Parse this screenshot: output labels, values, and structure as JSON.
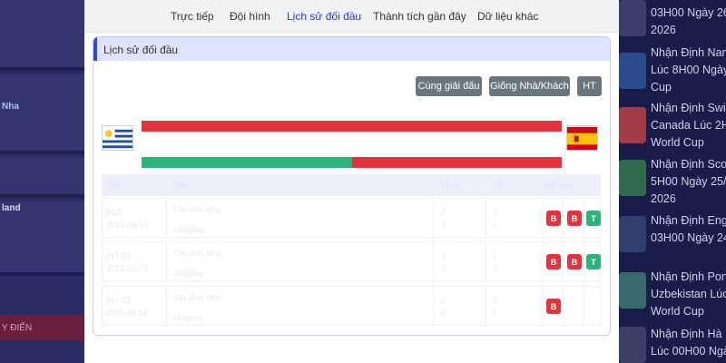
{
  "left_sidebar": {
    "item_1": "Nha",
    "item_2": "land",
    "bar_label": "Y ĐIỂN"
  },
  "right_sidebar": {
    "news": [
      {
        "lines": [
          "03H00 Ngày 26",
          "2026"
        ]
      },
      {
        "lines": [
          "Nhận Định Nam",
          "Lúc 8H00 Ngày",
          "Cup"
        ]
      },
      {
        "lines": [
          "Nhận Định Swi",
          "Canada Lúc 2H",
          "World Cup"
        ]
      },
      {
        "lines": [
          "Nhận Định Scot",
          "5H00 Ngày 25/",
          "2026"
        ]
      },
      {
        "lines": [
          "Nhận Định Eng",
          "03H00 Ngày 24"
        ]
      },
      {
        "lines": [
          "Nhận Định Port",
          "Uzbekistan Lúc",
          "World Cup"
        ]
      },
      {
        "lines": [
          "Nhận Định Hà I",
          "Lúc 00H00 Ngày"
        ]
      }
    ]
  },
  "tabs": [
    {
      "label": "Trực tiếp",
      "active": false
    },
    {
      "label": "Đội hình",
      "active": false
    },
    {
      "label": "Lịch sử đối đầu",
      "active": true
    },
    {
      "label": "Thành tích gần đây",
      "active": false
    },
    {
      "label": "Dữ liệu khác",
      "active": false
    }
  ],
  "panel": {
    "title": "Lịch sử đối đầu",
    "filters": [
      {
        "label": "Cùng giải đấu"
      },
      {
        "label": "Giống Nhà/Khách"
      },
      {
        "label": "HT"
      }
    ]
  },
  "summary": {
    "home_team_flag": "uruguay-flag",
    "away_team_flag": "spain-flag",
    "bar1_green_fraction": 0.0,
    "bar2_green_fraction": 0.5,
    "colors": {
      "win": "#2cb27a",
      "loss": "#e2343f"
    }
  },
  "table": {
    "headers": [
      "Giải",
      "Chủ",
      "Tỷ số",
      "HT",
      "Kết quả",
      ""
    ],
    "rows": [
      {
        "league": "FCC",
        "date": "2013-06-17",
        "home": "Tây Ban Nha",
        "away": "Uruguay",
        "score_home": "2",
        "score_away": "1",
        "ht_home": "2",
        "ht_away": "0",
        "results": [
          "B",
          "B",
          "T"
        ]
      },
      {
        "league": "INT CF",
        "date": "2013-02-07",
        "home": "Tây Ban Nha",
        "away": "Uruguay",
        "score_home": "1",
        "score_away": "1",
        "ht_home": "1",
        "ht_away": "1",
        "results": [
          "B",
          "B",
          "T"
        ]
      },
      {
        "league": "INT CF",
        "date": "2005-08-18",
        "home": "Tây Ban Nha",
        "away": "Uruguay",
        "score_home": "2",
        "score_away": "0",
        "ht_home": "2",
        "ht_away": "0",
        "results": [
          "B"
        ]
      }
    ]
  }
}
